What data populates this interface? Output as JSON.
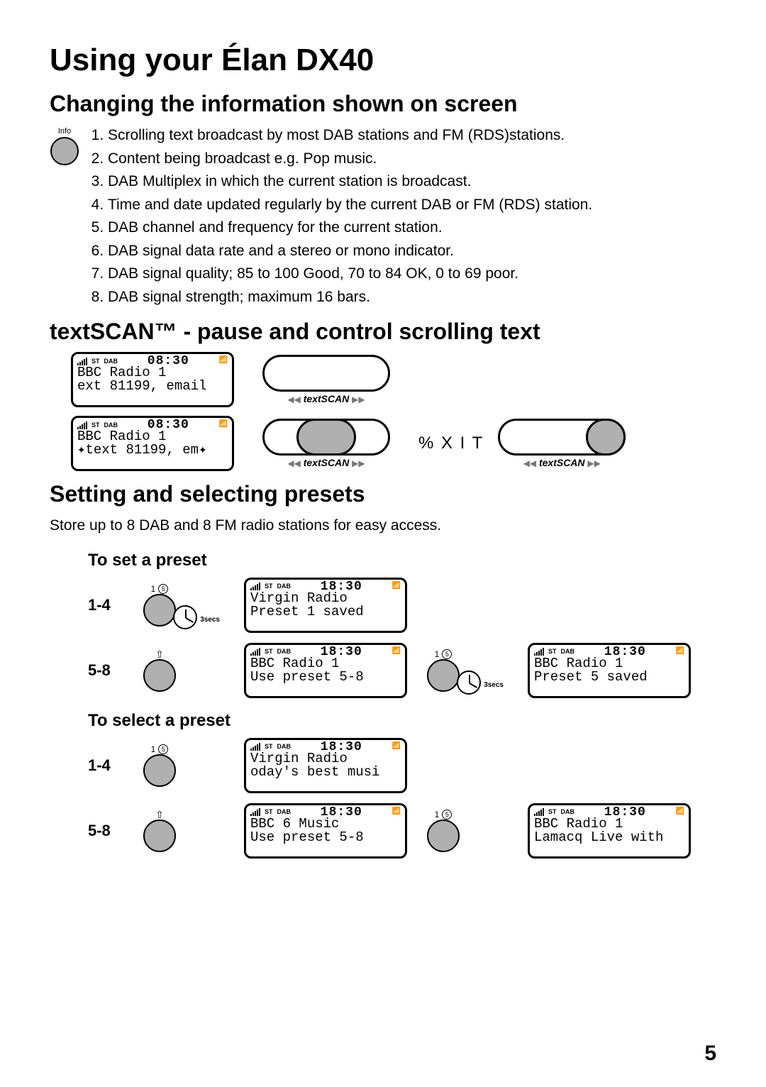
{
  "page_title": "Using your Élan DX40",
  "page_number": "5",
  "section1": {
    "heading": "Changing the information shown on screen",
    "info_label": "Info",
    "items": [
      "Scrolling text broadcast by most DAB stations and FM (RDS)stations.",
      "Content being broadcast e.g. Pop music.",
      "DAB Multiplex in which the current station is broadcast.",
      "Time and date updated regularly by the current DAB or FM (RDS) station.",
      "DAB channel and frequency for the current station.",
      "DAB signal data rate and a stereo or mono indicator.",
      "DAB signal quality; 85 to 100 Good, 70 to 84 OK, 0 to 69 poor.",
      "DAB signal strength; maximum 16 bars."
    ]
  },
  "section2": {
    "heading": "textSCAN™ - pause and control scrolling text",
    "lcd1": {
      "time": "08:30",
      "line1": "BBC Radio 1",
      "line2": "ext 81199, email"
    },
    "lcd2": {
      "time": "08:30",
      "line1": "BBC Radio 1",
      "line2": "✦text 81199, em✦"
    },
    "exit_label": "% X I T",
    "pill_label_rew": "◀◀",
    "pill_label_text": "textSCAN",
    "pill_label_ff": "▶▶"
  },
  "section3": {
    "heading": "Setting and selecting presets",
    "intro": "Store up to 8 DAB and 8 FM radio stations for easy access.",
    "sub1": "To set a preset",
    "sub2": "To select a preset",
    "range14": "1-4",
    "range58": "5-8",
    "preset_sup1": "1",
    "preset_sup5": "5",
    "hold_secs": "3",
    "hold_label": "secs",
    "lcd_set14": {
      "time": "18:30",
      "line1": "Virgin Radio",
      "line2": "Preset 1 saved"
    },
    "lcd_set58a": {
      "time": "18:30",
      "line1": "BBC Radio 1",
      "line2": "Use preset 5-8"
    },
    "lcd_set58b": {
      "time": "18:30",
      "line1": "BBC Radio 1",
      "line2": "Preset 5 saved"
    },
    "lcd_sel14": {
      "time": "18:30",
      "line1": "Virgin Radio",
      "line2": "oday's best musi"
    },
    "lcd_sel58a": {
      "time": "18:30",
      "line1": "BBC 6 Music",
      "line2": "Use preset 5-8"
    },
    "lcd_sel58b": {
      "time": "18:30",
      "line1": "BBC Radio 1",
      "line2": "Lamacq Live with"
    },
    "status_st": "ST",
    "status_dab": "DAB"
  }
}
